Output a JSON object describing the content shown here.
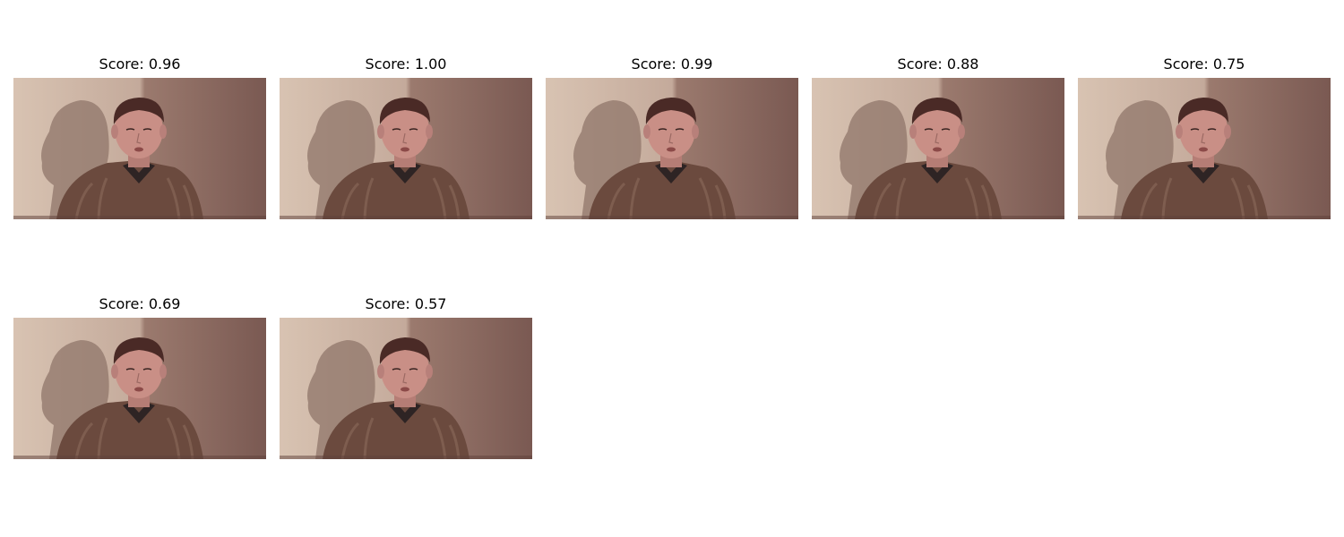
{
  "panels": [
    {
      "title": "Score: 0.96",
      "score": 0.96
    },
    {
      "title": "Score: 1.00",
      "score": 1.0
    },
    {
      "title": "Score: 0.99",
      "score": 0.99
    },
    {
      "title": "Score: 0.88",
      "score": 0.88
    },
    {
      "title": "Score: 0.75",
      "score": 0.75
    },
    {
      "title": "Score: 0.69",
      "score": 0.69
    },
    {
      "title": "Score: 0.57",
      "score": 0.57
    }
  ],
  "colors": {
    "background": "#ffffff",
    "wall_light": "#d8c3b2",
    "wall_dark": "#7a5952",
    "shadow": "#8f756a",
    "skin": "#c98f86",
    "hair": "#4a2a26",
    "sweater": "#6b4a3e"
  }
}
